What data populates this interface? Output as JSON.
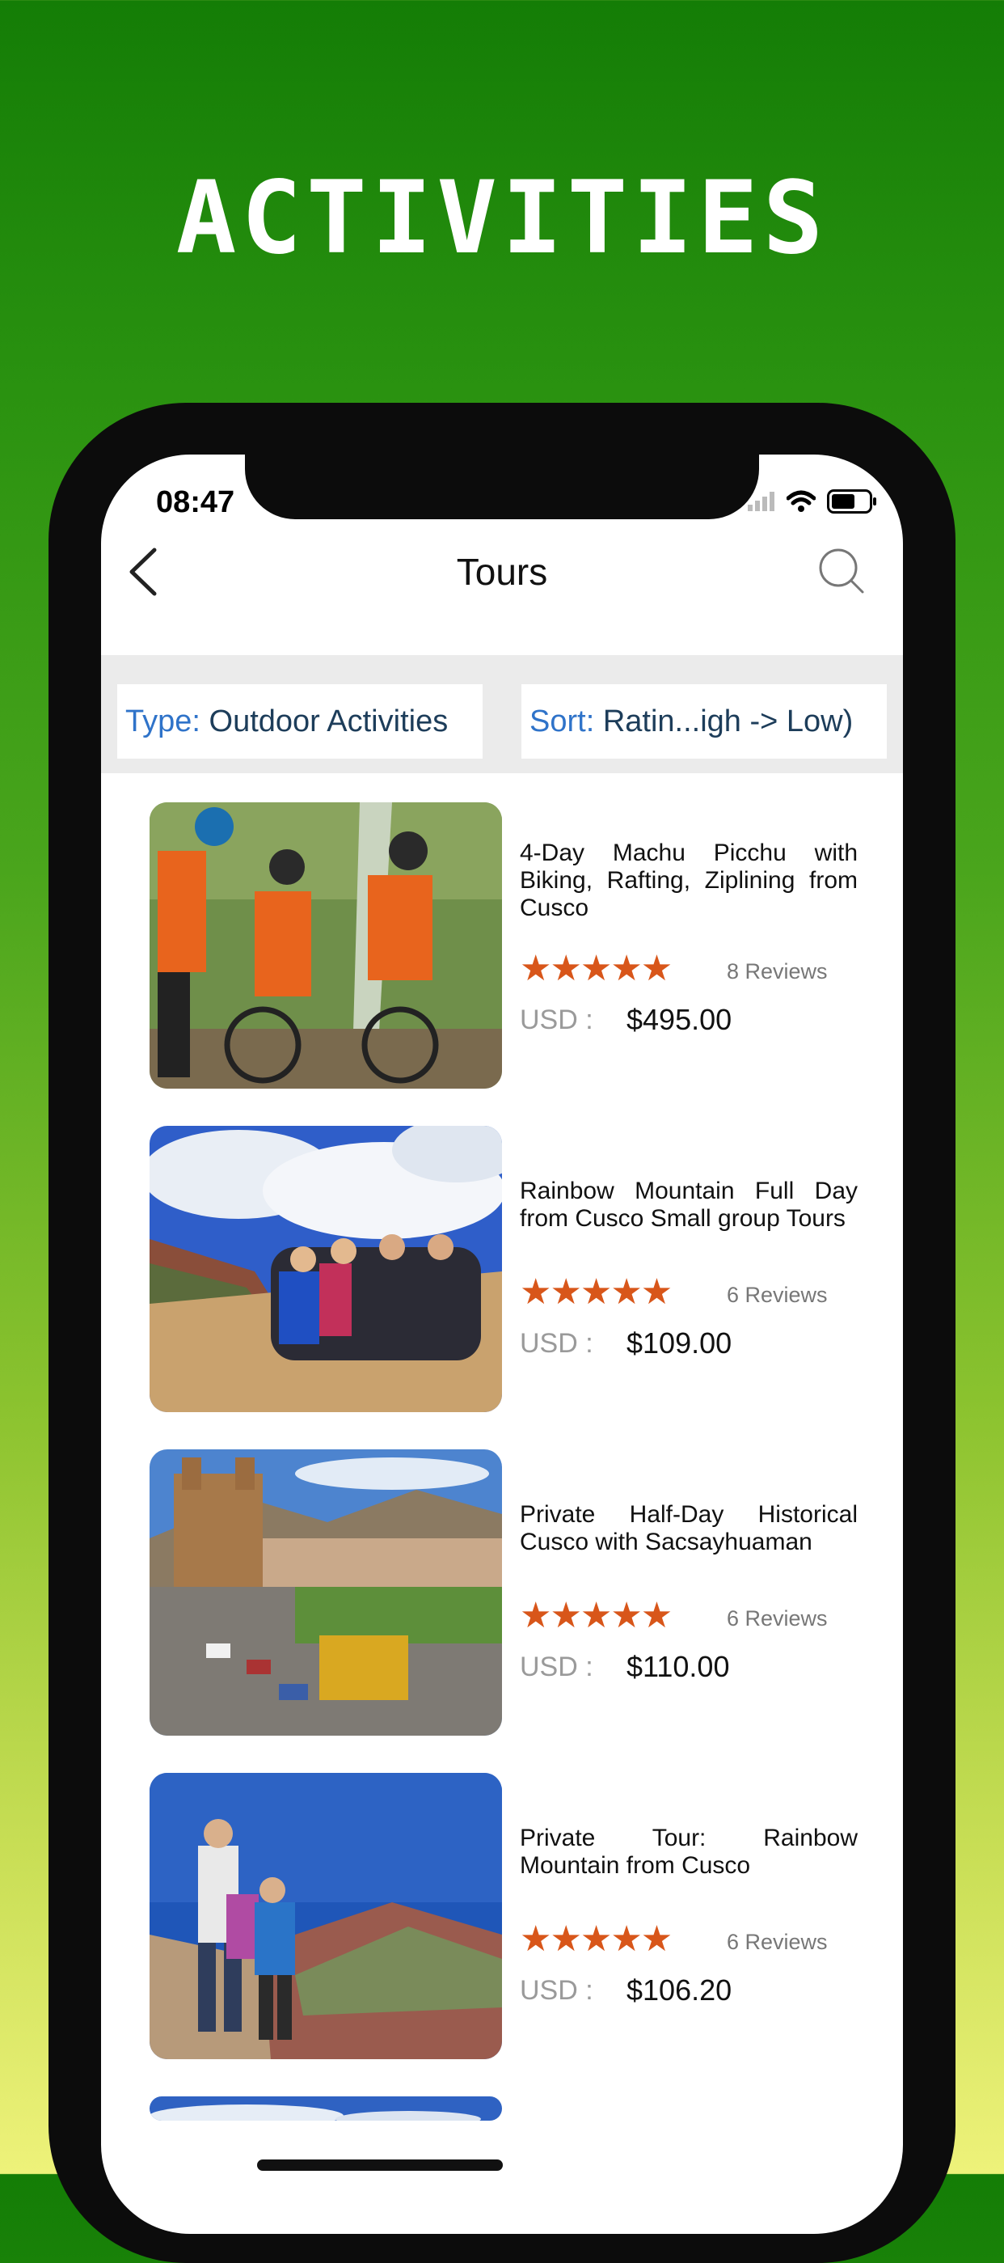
{
  "promo": {
    "headline": "ACTIVITIES"
  },
  "status_bar": {
    "time": "08:47",
    "icons": [
      "signal-icon",
      "wifi-icon",
      "battery-icon"
    ]
  },
  "nav": {
    "title": "Tours",
    "back_icon": "chevron-left-icon",
    "search_icon": "search-icon"
  },
  "filters": {
    "type_key": "Type:",
    "type_value": "Outdoor Activities",
    "sort_key": "Sort:",
    "sort_value": "Ratin...igh -> Low)"
  },
  "tours": [
    {
      "title": "4-Day Machu Picchu with Biking, Rafting, Ziplining from Cusco",
      "stars": "★★★★★",
      "rating": 5,
      "reviews": "8 Reviews",
      "currency": "USD :",
      "price": "$495.00",
      "image": "mountain-bikers-photo"
    },
    {
      "title": "Rainbow Mountain Full Day from Cusco Small group Tours",
      "stars": "★★★★★",
      "rating": 5,
      "reviews": "6 Reviews",
      "currency": "USD :",
      "price": "$109.00",
      "image": "rainbow-mountain-group-photo"
    },
    {
      "title": "Private Half-Day Historical Cusco with Sacsayhuaman",
      "stars": "★★★★★",
      "rating": 5,
      "reviews": "6 Reviews",
      "currency": "USD :",
      "price": "$110.00",
      "image": "cusco-plaza-photo"
    },
    {
      "title": "Private Tour: Rainbow Mountain from Cusco",
      "stars": "★★★★★",
      "rating": 5,
      "reviews": "6 Reviews",
      "currency": "USD :",
      "price": "$106.20",
      "image": "rainbow-mountain-family-photo"
    }
  ],
  "colors": {
    "accent": "#2f73c9",
    "star": "#d8561a",
    "bg_top": "#147d06",
    "bg_bottom": "#eef27a"
  }
}
